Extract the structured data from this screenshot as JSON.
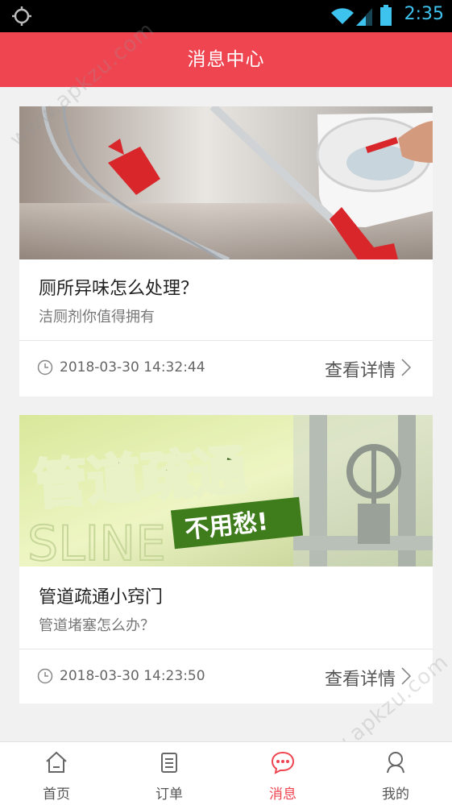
{
  "status_bar": {
    "time": "2:35"
  },
  "header": {
    "title": "消息中心"
  },
  "cards": [
    {
      "title": "厕所异味怎么处理？",
      "subtitle": "洁厕剂你值得拥有",
      "date": "2018-03-30 14:32:44",
      "more_label": "查看详情"
    },
    {
      "title": "管道疏通小窍门",
      "subtitle": "管道堵塞怎么办？",
      "date": "2018-03-30 14:23:50",
      "more_label": "查看详情",
      "banner_text": "管道疏通",
      "banner_badge": "不用愁!",
      "banner_bg_text": "SLINE"
    }
  ],
  "tabbar": {
    "items": [
      {
        "label": "首页",
        "icon": "home-icon"
      },
      {
        "label": "订单",
        "icon": "order-icon"
      },
      {
        "label": "消息",
        "icon": "message-icon",
        "active": true
      },
      {
        "label": "我的",
        "icon": "profile-icon"
      }
    ]
  },
  "watermark": "www.apkzu.com",
  "colors": {
    "accent": "#ef4551",
    "status_text": "#3ec3ee",
    "background": "#f1f1f1"
  }
}
